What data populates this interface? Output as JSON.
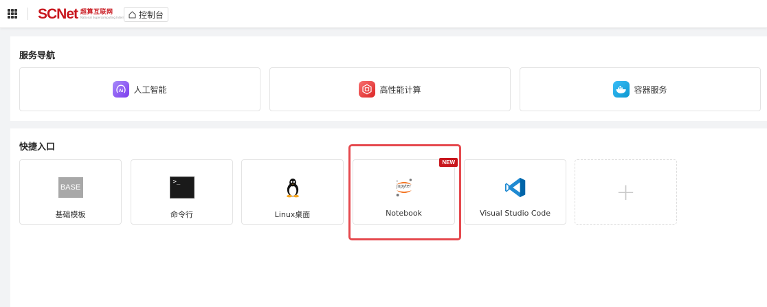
{
  "header": {
    "logo_text": "SCNet",
    "logo_sub_cn": "超算互联网",
    "logo_sub_en": "National Supercomputing Internet",
    "console_label": "控制台"
  },
  "services": {
    "title": "服务导航",
    "items": [
      {
        "label": "人工智能",
        "icon": "ai-icon",
        "icon_text": "Ai",
        "color": "#8b5cf6"
      },
      {
        "label": "高性能计算",
        "icon": "hpc-icon",
        "icon_text": "",
        "color": "#e5343a"
      },
      {
        "label": "容器服务",
        "icon": "docker-icon",
        "icon_text": "",
        "color": "#1ba6e0"
      }
    ]
  },
  "quick": {
    "title": "快捷入口",
    "items": [
      {
        "label": "基础模板",
        "icon": "base-template-icon",
        "icon_text": "BASE"
      },
      {
        "label": "命令行",
        "icon": "terminal-icon",
        "icon_text": ">_"
      },
      {
        "label": "Linux桌面",
        "icon": "linux-tux-icon",
        "icon_text": ""
      },
      {
        "label": "Notebook",
        "icon": "jupyter-icon",
        "icon_text": "jupyter",
        "badge": "NEW"
      },
      {
        "label": "Visual Studio Code",
        "icon": "vscode-icon",
        "icon_text": ""
      }
    ],
    "add_label": "+"
  }
}
